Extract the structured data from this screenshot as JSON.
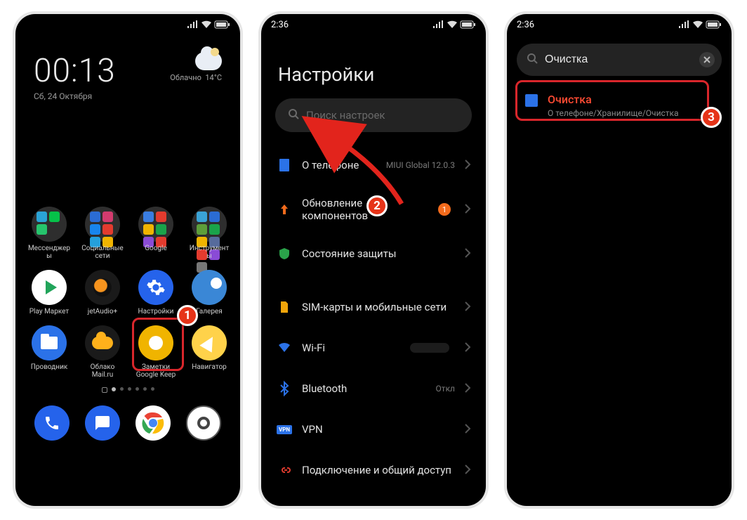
{
  "phone1": {
    "statusbar": {
      "time": ""
    },
    "clock": {
      "time": "00:13",
      "date": "Сб, 24 Октября"
    },
    "weather": {
      "desc": "Облачно",
      "temp": "14°C"
    },
    "folders": [
      {
        "label": "Мессенджер\nы",
        "minis": [
          "#2aa3d6",
          "#06c149",
          "#26c46c"
        ]
      },
      {
        "label": "Социальные\nсети",
        "minis": [
          "#2b6cd4",
          "#d23b6e",
          "#1885ed",
          "#e33b2e",
          "#24a0dc",
          "#f0b400"
        ]
      },
      {
        "label": "Google",
        "minis": [
          "#3a7de0",
          "#e33b2e",
          "#f0b400",
          "#1aa34a",
          "#8a4bd6",
          "#e33b2e"
        ]
      },
      {
        "label": "Инструмент\nы",
        "minis": [
          "#3aa3d6",
          "#2b6cd4",
          "#5d9e3a",
          "#1aa34a",
          "#f0b400",
          "#566b9c",
          "#e33b2e",
          "#8a4bd6",
          "#777"
        ]
      }
    ],
    "apps_row2": [
      {
        "label": "Play Маркет",
        "cls": "icon-play"
      },
      {
        "label": "jetAudio+",
        "cls": "icon-jet"
      },
      {
        "label": "Настройки",
        "cls": "icon-settings"
      },
      {
        "label": "Галерея",
        "cls": "icon-gallery"
      }
    ],
    "apps_row3": [
      {
        "label": "Проводник",
        "cls": "icon-folder"
      },
      {
        "label": "Облако\nMail.ru",
        "cls": "icon-cloud"
      },
      {
        "label": "Заметки\nGoogle Keep",
        "cls": "icon-keep"
      },
      {
        "label": "Навигатор",
        "cls": "icon-nav"
      }
    ],
    "dock": [
      {
        "name": "phone-app",
        "cls": "icon-phone"
      },
      {
        "name": "messages-app",
        "cls": "icon-msg"
      },
      {
        "name": "chrome-app",
        "cls": "icon-chrome"
      },
      {
        "name": "camera-app",
        "cls": "icon-cam"
      }
    ],
    "badge": "1"
  },
  "phone2": {
    "statusbar": {
      "time": "2:36"
    },
    "title": "Настройки",
    "search_placeholder": "Поиск настроек",
    "items": [
      {
        "icon": "about",
        "title": "О телефоне",
        "meta": "MIUI Global 12.0.3",
        "color": "#2b72e8"
      },
      {
        "icon": "update",
        "title": "Обновление\nкомпонентов",
        "meta": "",
        "badge": "1",
        "color": "#f36b1c"
      },
      {
        "icon": "shield",
        "title": "Состояние защиты",
        "meta": "",
        "color": "#2aa34a"
      },
      {
        "icon": "sim",
        "title": "SIM-карты и мобильные\nсети",
        "meta": "",
        "color": "#f0a50a"
      },
      {
        "icon": "wifi",
        "title": "Wi-Fi",
        "meta": "",
        "wifi_pill": true,
        "color": "#2b72e8"
      },
      {
        "icon": "bt",
        "title": "Bluetooth",
        "meta": "Откл",
        "color": "#2b72e8"
      },
      {
        "icon": "vpn",
        "title": "VPN",
        "meta": "",
        "color": "#2b72e8",
        "vpnbox": true
      },
      {
        "icon": "link",
        "title": "Подключение и общий\nдоступ",
        "meta": "",
        "color": "#e03b2e"
      }
    ],
    "badge": "2"
  },
  "phone3": {
    "statusbar": {
      "time": "2:36"
    },
    "search_value": "Очистка",
    "result": {
      "title": "Очистка",
      "path": "О телефоне/Хранилище/Очистка"
    },
    "badge": "3"
  }
}
